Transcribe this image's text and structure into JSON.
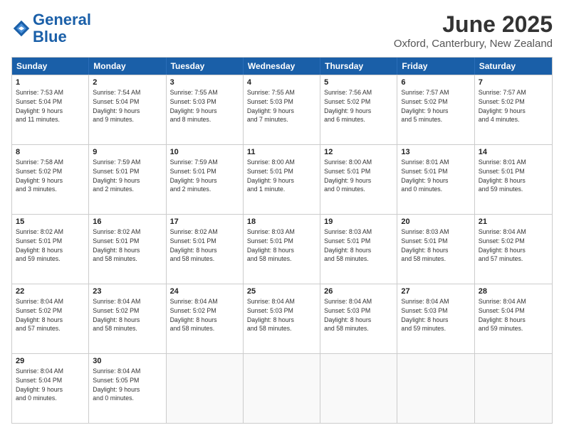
{
  "logo": {
    "line1": "General",
    "line2": "Blue"
  },
  "title": "June 2025",
  "location": "Oxford, Canterbury, New Zealand",
  "header_days": [
    "Sunday",
    "Monday",
    "Tuesday",
    "Wednesday",
    "Thursday",
    "Friday",
    "Saturday"
  ],
  "weeks": [
    [
      {
        "day": "1",
        "info": "Sunrise: 7:53 AM\nSunset: 5:04 PM\nDaylight: 9 hours\nand 11 minutes."
      },
      {
        "day": "2",
        "info": "Sunrise: 7:54 AM\nSunset: 5:04 PM\nDaylight: 9 hours\nand 9 minutes."
      },
      {
        "day": "3",
        "info": "Sunrise: 7:55 AM\nSunset: 5:03 PM\nDaylight: 9 hours\nand 8 minutes."
      },
      {
        "day": "4",
        "info": "Sunrise: 7:55 AM\nSunset: 5:03 PM\nDaylight: 9 hours\nand 7 minutes."
      },
      {
        "day": "5",
        "info": "Sunrise: 7:56 AM\nSunset: 5:02 PM\nDaylight: 9 hours\nand 6 minutes."
      },
      {
        "day": "6",
        "info": "Sunrise: 7:57 AM\nSunset: 5:02 PM\nDaylight: 9 hours\nand 5 minutes."
      },
      {
        "day": "7",
        "info": "Sunrise: 7:57 AM\nSunset: 5:02 PM\nDaylight: 9 hours\nand 4 minutes."
      }
    ],
    [
      {
        "day": "8",
        "info": "Sunrise: 7:58 AM\nSunset: 5:02 PM\nDaylight: 9 hours\nand 3 minutes."
      },
      {
        "day": "9",
        "info": "Sunrise: 7:59 AM\nSunset: 5:01 PM\nDaylight: 9 hours\nand 2 minutes."
      },
      {
        "day": "10",
        "info": "Sunrise: 7:59 AM\nSunset: 5:01 PM\nDaylight: 9 hours\nand 2 minutes."
      },
      {
        "day": "11",
        "info": "Sunrise: 8:00 AM\nSunset: 5:01 PM\nDaylight: 9 hours\nand 1 minute."
      },
      {
        "day": "12",
        "info": "Sunrise: 8:00 AM\nSunset: 5:01 PM\nDaylight: 9 hours\nand 0 minutes."
      },
      {
        "day": "13",
        "info": "Sunrise: 8:01 AM\nSunset: 5:01 PM\nDaylight: 9 hours\nand 0 minutes."
      },
      {
        "day": "14",
        "info": "Sunrise: 8:01 AM\nSunset: 5:01 PM\nDaylight: 8 hours\nand 59 minutes."
      }
    ],
    [
      {
        "day": "15",
        "info": "Sunrise: 8:02 AM\nSunset: 5:01 PM\nDaylight: 8 hours\nand 59 minutes."
      },
      {
        "day": "16",
        "info": "Sunrise: 8:02 AM\nSunset: 5:01 PM\nDaylight: 8 hours\nand 58 minutes."
      },
      {
        "day": "17",
        "info": "Sunrise: 8:02 AM\nSunset: 5:01 PM\nDaylight: 8 hours\nand 58 minutes."
      },
      {
        "day": "18",
        "info": "Sunrise: 8:03 AM\nSunset: 5:01 PM\nDaylight: 8 hours\nand 58 minutes."
      },
      {
        "day": "19",
        "info": "Sunrise: 8:03 AM\nSunset: 5:01 PM\nDaylight: 8 hours\nand 58 minutes."
      },
      {
        "day": "20",
        "info": "Sunrise: 8:03 AM\nSunset: 5:01 PM\nDaylight: 8 hours\nand 58 minutes."
      },
      {
        "day": "21",
        "info": "Sunrise: 8:04 AM\nSunset: 5:02 PM\nDaylight: 8 hours\nand 57 minutes."
      }
    ],
    [
      {
        "day": "22",
        "info": "Sunrise: 8:04 AM\nSunset: 5:02 PM\nDaylight: 8 hours\nand 57 minutes."
      },
      {
        "day": "23",
        "info": "Sunrise: 8:04 AM\nSunset: 5:02 PM\nDaylight: 8 hours\nand 58 minutes."
      },
      {
        "day": "24",
        "info": "Sunrise: 8:04 AM\nSunset: 5:02 PM\nDaylight: 8 hours\nand 58 minutes."
      },
      {
        "day": "25",
        "info": "Sunrise: 8:04 AM\nSunset: 5:03 PM\nDaylight: 8 hours\nand 58 minutes."
      },
      {
        "day": "26",
        "info": "Sunrise: 8:04 AM\nSunset: 5:03 PM\nDaylight: 8 hours\nand 58 minutes."
      },
      {
        "day": "27",
        "info": "Sunrise: 8:04 AM\nSunset: 5:03 PM\nDaylight: 8 hours\nand 59 minutes."
      },
      {
        "day": "28",
        "info": "Sunrise: 8:04 AM\nSunset: 5:04 PM\nDaylight: 8 hours\nand 59 minutes."
      }
    ],
    [
      {
        "day": "29",
        "info": "Sunrise: 8:04 AM\nSunset: 5:04 PM\nDaylight: 9 hours\nand 0 minutes."
      },
      {
        "day": "30",
        "info": "Sunrise: 8:04 AM\nSunset: 5:05 PM\nDaylight: 9 hours\nand 0 minutes."
      },
      {
        "day": "",
        "info": ""
      },
      {
        "day": "",
        "info": ""
      },
      {
        "day": "",
        "info": ""
      },
      {
        "day": "",
        "info": ""
      },
      {
        "day": "",
        "info": ""
      }
    ]
  ]
}
